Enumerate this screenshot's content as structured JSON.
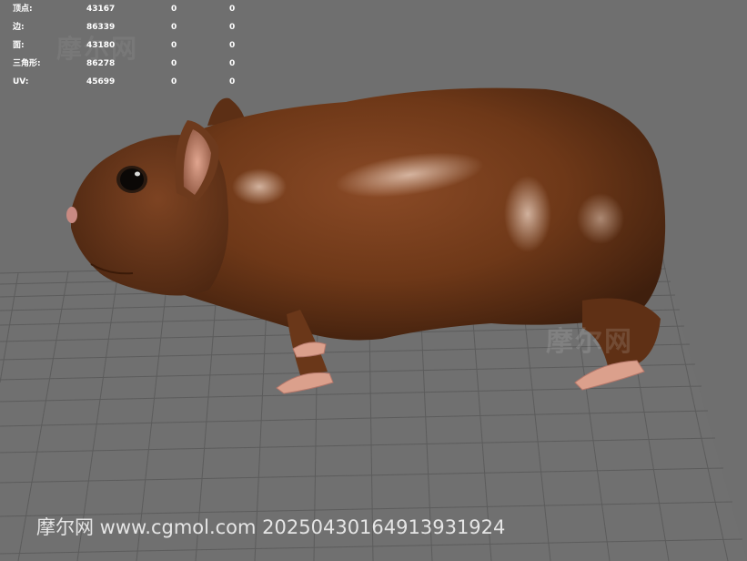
{
  "viewport": {
    "subject_icon": "hamster-3d-model-icon",
    "background_color": "#6f6f6f",
    "grid_color": "#5a5a5a"
  },
  "stats": {
    "rows": [
      {
        "label": "顶点:",
        "total": "43167",
        "selected": "0",
        "extra": "0"
      },
      {
        "label": "边:",
        "total": "86339",
        "selected": "0",
        "extra": "0"
      },
      {
        "label": "面:",
        "total": "43180",
        "selected": "0",
        "extra": "0"
      },
      {
        "label": "三角形:",
        "total": "86278",
        "selected": "0",
        "extra": "0"
      },
      {
        "label": "UV:",
        "total": "45699",
        "selected": "0",
        "extra": "0"
      }
    ]
  },
  "watermarks": {
    "top_logo": "摩尔网",
    "middle_logo": "摩尔网",
    "footer": "摩尔网 www.cgmol.com 20250430164913931924"
  }
}
